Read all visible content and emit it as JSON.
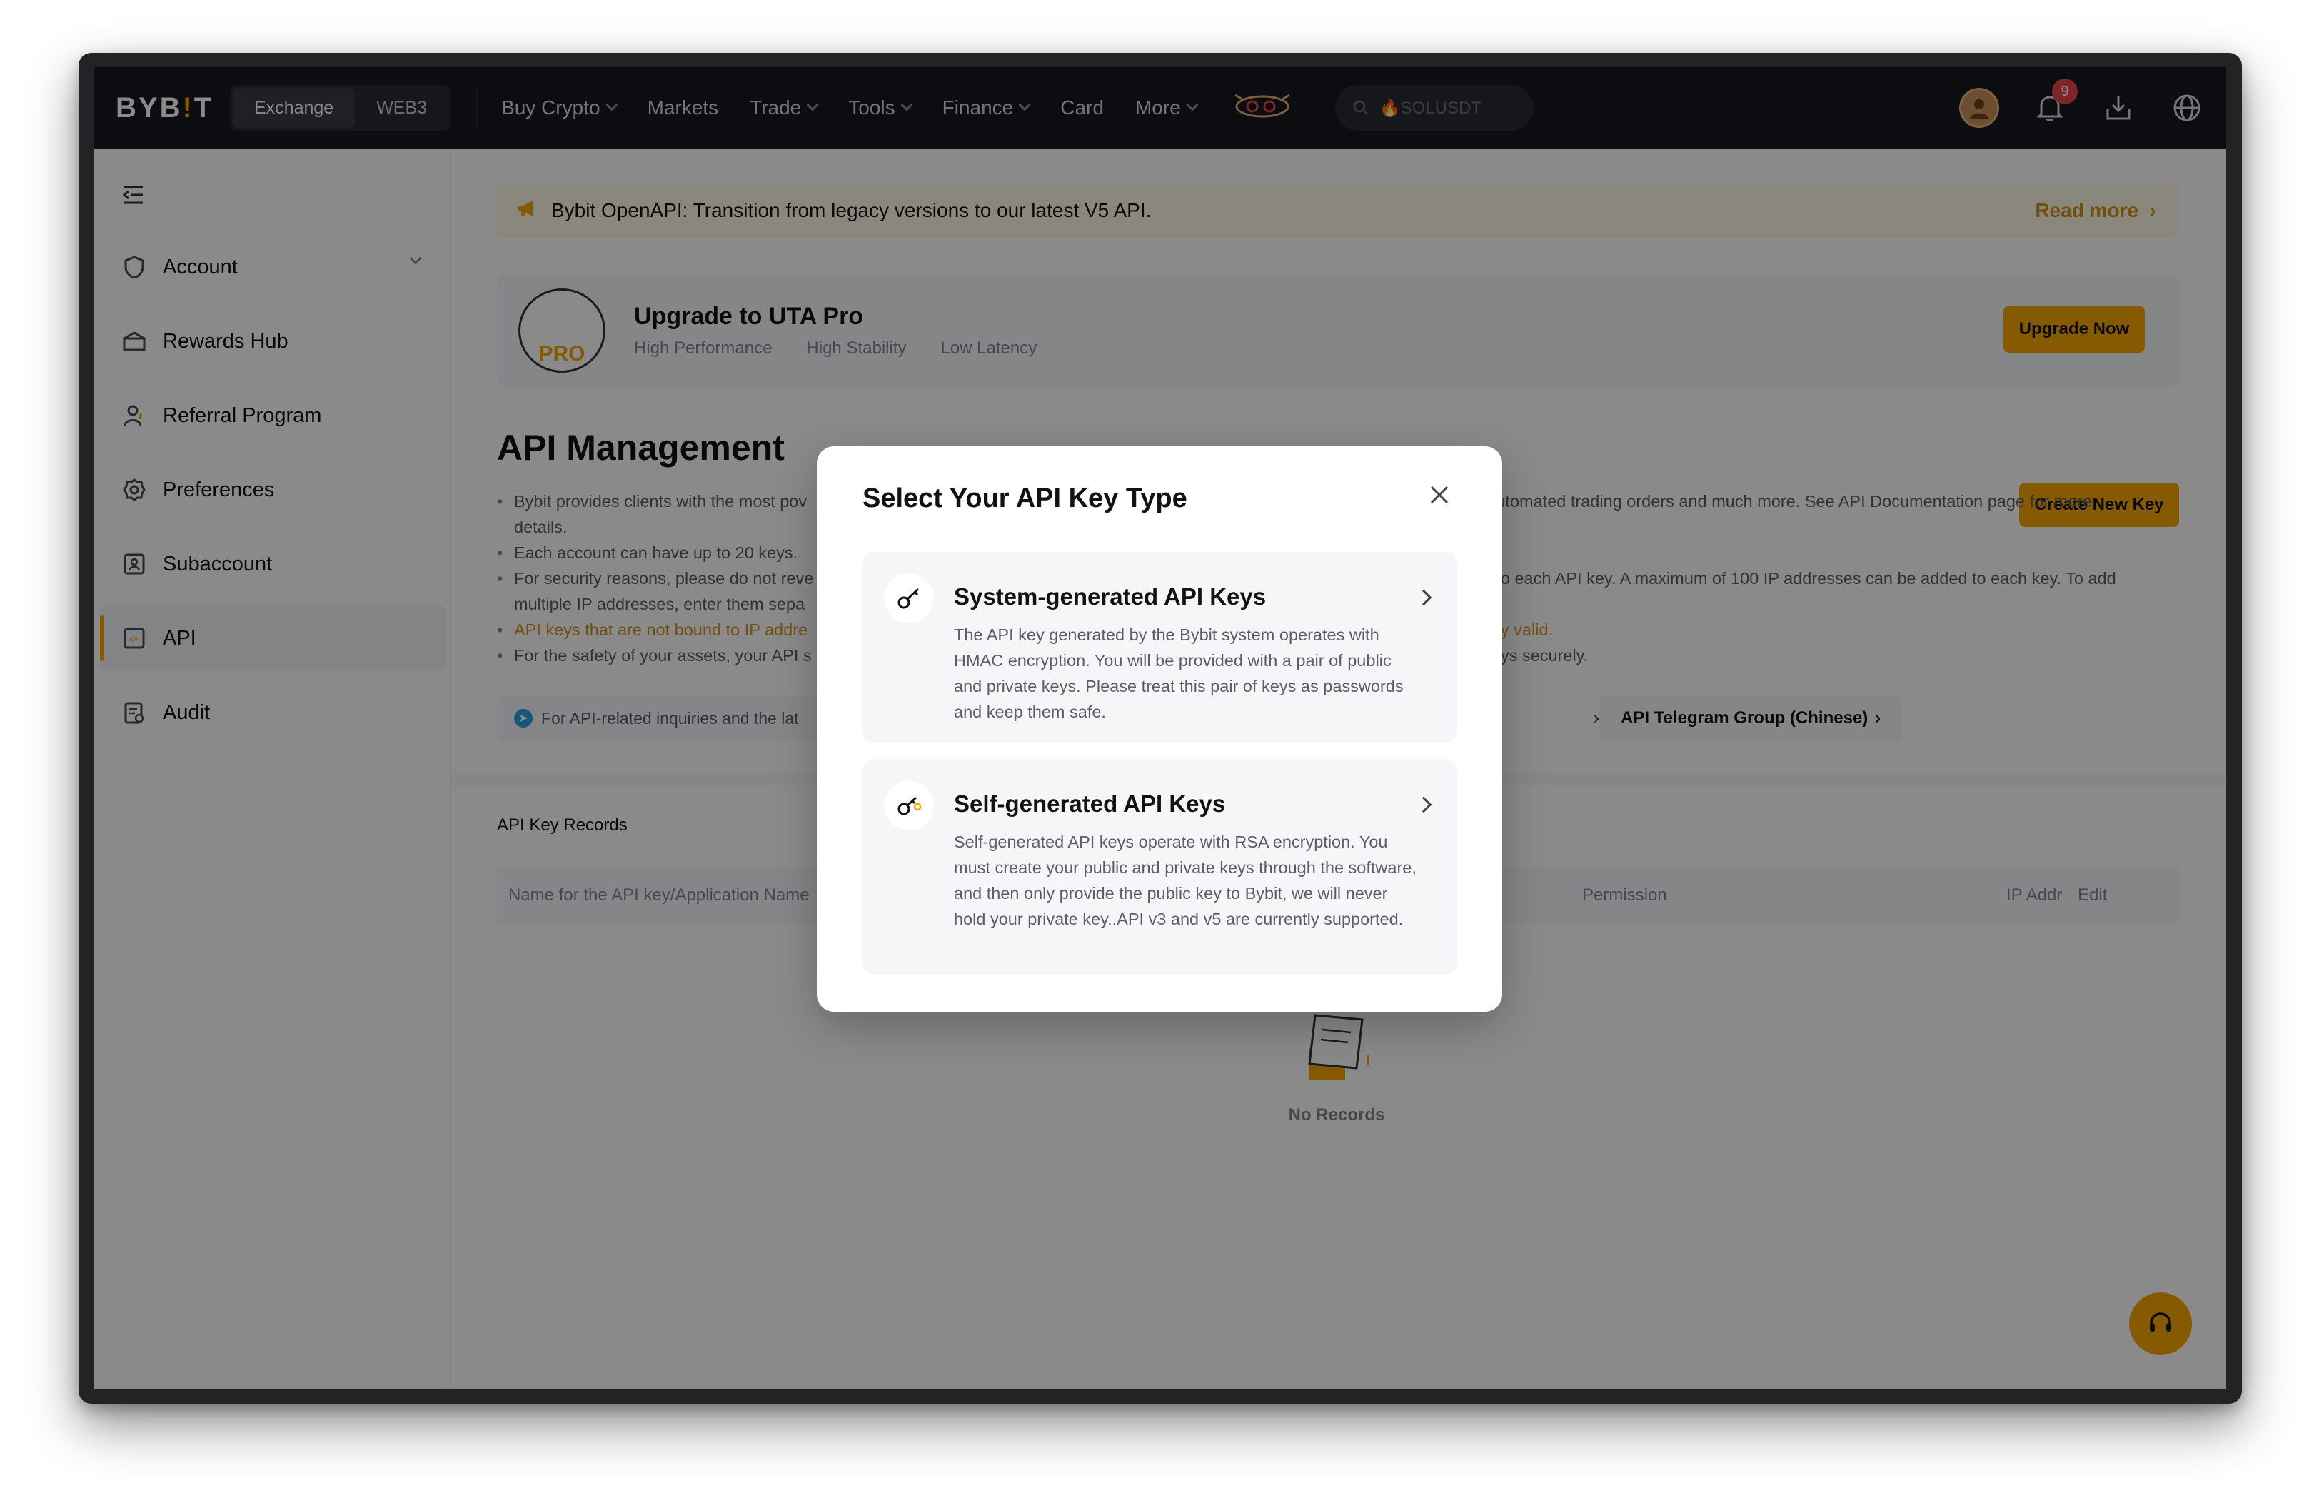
{
  "header": {
    "logo_main": "BYB",
    "logo_bar": "!",
    "logo_end": "T",
    "segments": [
      "Exchange",
      "WEB3"
    ],
    "nav": [
      {
        "label": "Buy Crypto",
        "dropdown": true
      },
      {
        "label": "Markets",
        "dropdown": false
      },
      {
        "label": "Trade",
        "dropdown": true
      },
      {
        "label": "Tools",
        "dropdown": true
      },
      {
        "label": "Finance",
        "dropdown": true
      },
      {
        "label": "Card",
        "dropdown": false
      },
      {
        "label": "More",
        "dropdown": true
      }
    ],
    "search_placeholder": "🔥SOLUSDT",
    "notification_count": "9"
  },
  "sidebar": {
    "items": [
      {
        "label": "Account",
        "icon": "shield-icon"
      },
      {
        "label": "Rewards Hub",
        "icon": "gift-icon"
      },
      {
        "label": "Referral Program",
        "icon": "user-plus-icon"
      },
      {
        "label": "Preferences",
        "icon": "gear-icon"
      },
      {
        "label": "Subaccount",
        "icon": "subaccount-icon"
      },
      {
        "label": "API",
        "icon": "api-icon"
      },
      {
        "label": "Audit",
        "icon": "audit-icon"
      }
    ],
    "active": "API"
  },
  "main": {
    "announcement": "Bybit OpenAPI: Transition from legacy versions to our latest V5 API.",
    "read_more": "Read more",
    "uta": {
      "title": "Upgrade to UTA Pro",
      "tags": [
        "High Performance",
        "High Stability",
        "Low Latency"
      ],
      "button": "Upgrade Now",
      "badge_text": "PRO"
    },
    "page_title": "API Management",
    "create_button": "Create New Key",
    "description": [
      {
        "left": "Bybit provides clients with the most pov",
        "right": "s automated trading orders and much more. See API Documentation page for more",
        "cont": "details."
      },
      {
        "left": "Each account can have up to 20 keys.",
        "right": "",
        "cont": ""
      },
      {
        "left": "For security reasons, please do not reve",
        "right": "es to each API key. A maximum of 100 IP addresses can be added to each key. To add",
        "cont": "multiple IP addresses, enter them sepa"
      },
      {
        "left": "API keys that are not bound to IP addre",
        "right": "ently valid.",
        "cont": ""
      },
      {
        "left": "For the safety of your assets, your API s",
        "right": "I keys securely.",
        "cont": ""
      }
    ],
    "inquiry": "For API-related inquiries and the lat",
    "telegram_link": "API Telegram Group (Chinese)",
    "records_label": "API Key Records",
    "table_headers": [
      "Name for the API key/Application Name",
      "Permission",
      "IP Addr",
      "Edit"
    ],
    "empty_label": "No Records"
  },
  "modal": {
    "title": "Select Your API Key Type",
    "options": [
      {
        "title": "System-generated API Keys",
        "desc": "The API key generated by the Bybit system operates with HMAC encryption. You will be provided with a pair of public and private keys. Please treat this pair of keys as passwords and keep them safe.",
        "icon": "key-icon"
      },
      {
        "title": "Self-generated API Keys",
        "desc": "Self-generated API keys operate with RSA encryption. You must create your public and private keys through the software, and then only provide the public key to Bybit, we will never hold your private key..API v3 and v5 are currently supported.",
        "icon": "self-key-icon"
      }
    ]
  },
  "colors": {
    "accent": "#f7a600",
    "header_bg": "#17181e",
    "warning_text": "#d39317"
  }
}
